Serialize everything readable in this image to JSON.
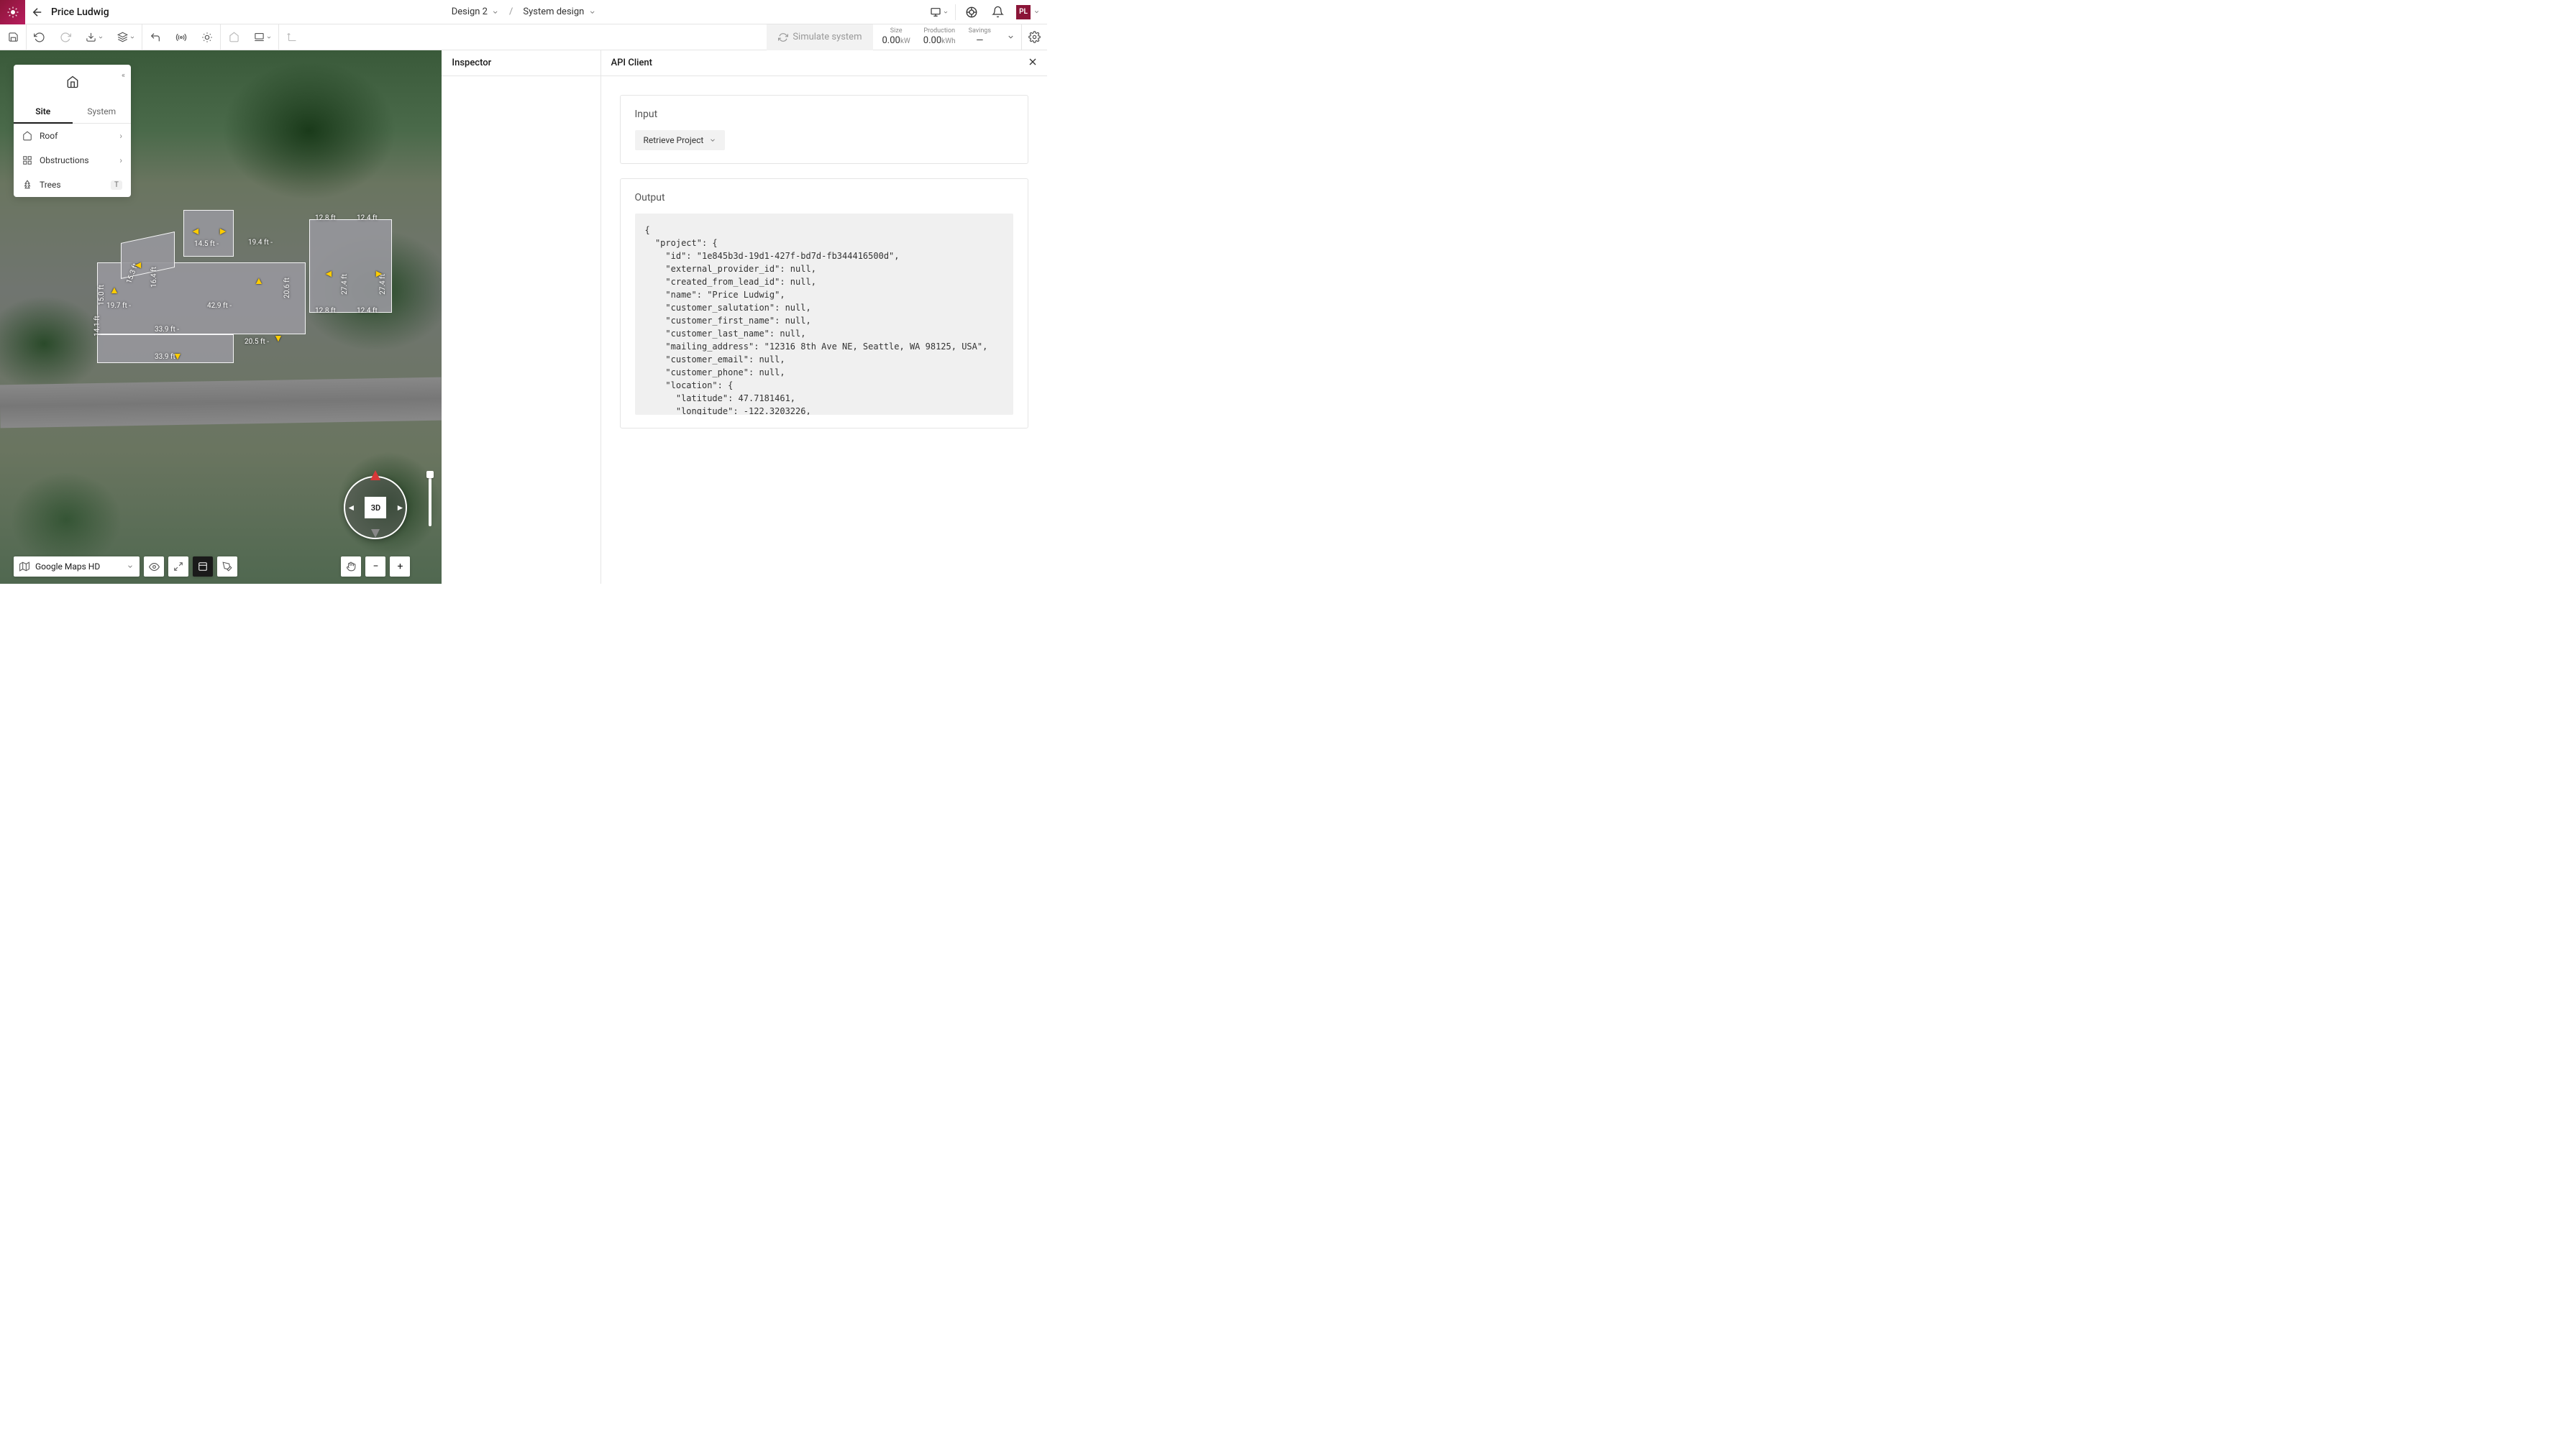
{
  "header": {
    "project_name": "Price Ludwig",
    "design_label": "Design 2",
    "view_label": "System design",
    "avatar_initials": "PL"
  },
  "toolbar": {
    "simulate_label": "Simulate system",
    "metrics": {
      "size_label": "Size",
      "size_value": "0.00",
      "size_unit": "kW",
      "production_label": "Production",
      "production_value": "0.00",
      "production_unit": "kWh",
      "savings_label": "Savings",
      "savings_value": "—"
    }
  },
  "left_panel": {
    "tab_site": "Site",
    "tab_system": "System",
    "item_roof": "Roof",
    "item_obstructions": "Obstructions",
    "item_trees": "Trees",
    "trees_shortcut": "T"
  },
  "map": {
    "basemap_label": "Google Maps HD",
    "view_mode": "3D",
    "roof_labels": [
      "12.8 ft",
      "12.4 ft",
      "14.5 ft -",
      "19.4 ft -",
      "20.6 ft",
      "27.4 ft",
      "27.4 ft",
      "15.0 ft",
      "19.7 ft -",
      "42.9 ft -",
      "12.8 ft",
      "12.4 ft",
      "33.9 ft -",
      "20.5 ft -",
      "33.9 ft",
      "14.1 ft",
      "15.3 ft",
      "16.4 ft"
    ]
  },
  "inspector": {
    "title": "Inspector"
  },
  "api": {
    "title": "API Client",
    "input_section": "Input",
    "operation_label": "Retrieve Project",
    "output_section": "Output",
    "output_code": "{\n  \"project\": {\n    \"id\": \"1e845b3d-19d1-427f-bd7d-fb344416500d\",\n    \"external_provider_id\": null,\n    \"created_from_lead_id\": null,\n    \"name\": \"Price Ludwig\",\n    \"customer_salutation\": null,\n    \"customer_first_name\": null,\n    \"customer_last_name\": null,\n    \"mailing_address\": \"12316 8th Ave NE, Seattle, WA 98125, USA\",\n    \"customer_email\": null,\n    \"customer_phone\": null,\n    \"location\": {\n      \"latitude\": 47.7181461,\n      \"longitude\": -122.3203226,\n      \"property_address\": \"12316 8th Ave NE, Seattle, WA 98125, USA\",\n      \"property_address_components\": {\n        \"street_address\": \"12316 8th Ave NE\""
  }
}
